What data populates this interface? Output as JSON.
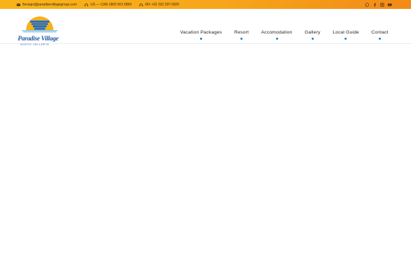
{
  "topbar": {
    "email": "flexiapv@paradisevillagegroup.com",
    "phone_us": "US — CAN 1800 501 6859",
    "phone_mx": "MX +52 322 297 0920",
    "social_icons": [
      "whatsapp-icon",
      "facebook-icon",
      "instagram-icon",
      "youtube-icon"
    ]
  },
  "logo": {
    "name": "Paradise Village",
    "subtitle": "NUEVO VALLARTA"
  },
  "nav": {
    "items": [
      "Vacation Packages",
      "Resort",
      "Accomodation",
      "Gallery",
      "Local Guide",
      "Contact"
    ]
  },
  "colors": {
    "topbar_start": "#f9b31a",
    "topbar_end": "#f28a17",
    "nav_dot": "#1a7fc4",
    "logo_blue": "#1f57a6"
  }
}
